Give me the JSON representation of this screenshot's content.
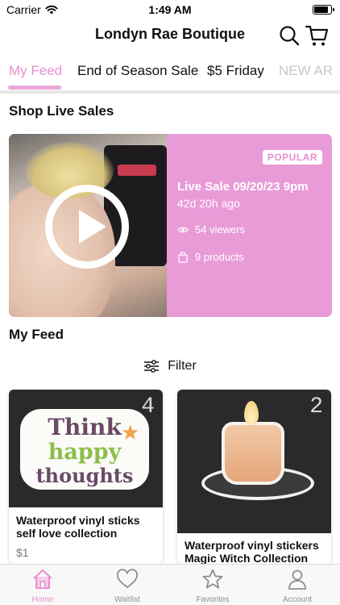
{
  "status_bar": {
    "carrier": "Carrier",
    "time": "1:49 AM",
    "battery_level": 0.9
  },
  "header": {
    "title": "Londyn Rae Boutique",
    "search_icon": "search-icon",
    "cart_icon": "cart-icon"
  },
  "tabs": [
    {
      "label": "My Feed",
      "active": true
    },
    {
      "label": "End of Season Sale",
      "active": false
    },
    {
      "label": "$5 Friday",
      "active": false
    },
    {
      "label": "NEW AR",
      "active": false
    }
  ],
  "shop_live": {
    "title": "Shop Live Sales",
    "card": {
      "badge": "POPULAR",
      "title": "Live Sale 09/20/23 9pm",
      "ago": "42d 20h ago",
      "viewers": "54 viewers",
      "products": "9 products",
      "play_icon": "play-icon"
    }
  },
  "feed": {
    "title": "My Feed",
    "filter_label": "Filter",
    "items": [
      {
        "number": "4",
        "sticker": {
          "line1": "Think",
          "line2": "happy",
          "line3": "thoughts"
        },
        "title_line1": "Waterproof vinyl sticks",
        "title_line2": "self love collection",
        "price": "$1"
      },
      {
        "number": "2",
        "title_line1": "Waterproof vinyl stickers",
        "title_line2": "Magic Witch Collection",
        "price": ""
      }
    ]
  },
  "bottom_nav": [
    {
      "label": "Home",
      "icon": "home-icon",
      "active": true
    },
    {
      "label": "Waitlist",
      "icon": "heart-icon",
      "active": false
    },
    {
      "label": "Favorites",
      "icon": "star-icon",
      "active": false
    },
    {
      "label": "Account",
      "icon": "account-icon",
      "active": false
    }
  ],
  "colors": {
    "accent": "#e78fcf",
    "card_pink": "#e99bd8",
    "tab_indicator": "#e9a8d9"
  }
}
